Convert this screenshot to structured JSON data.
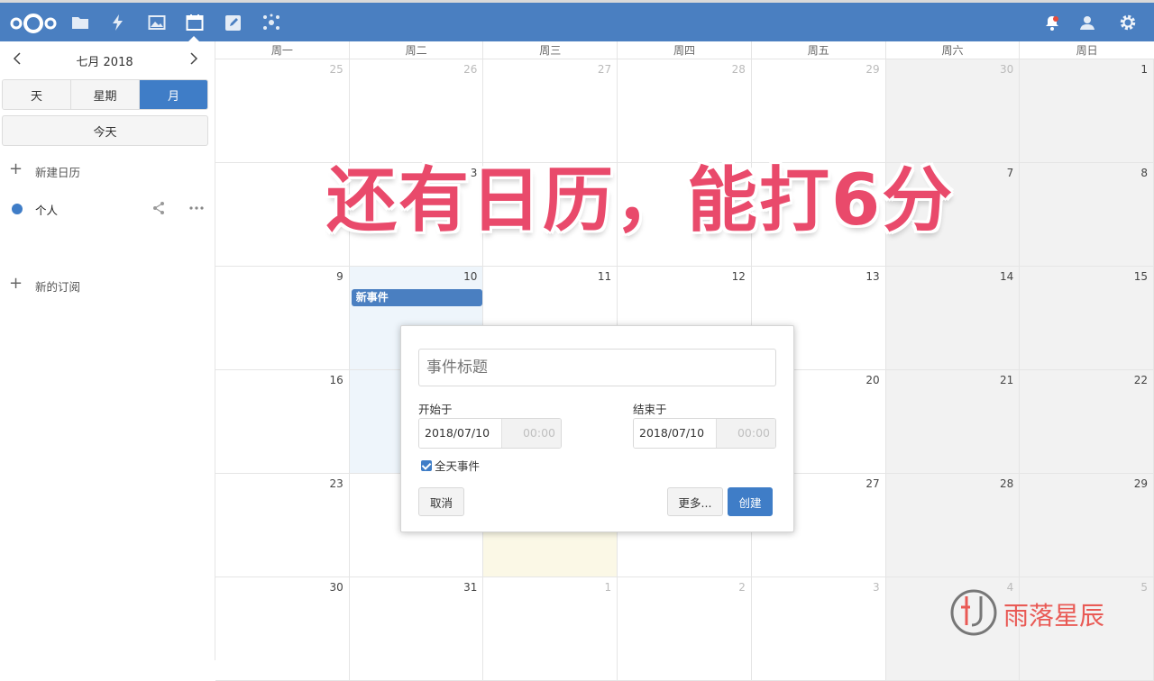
{
  "topbar": {
    "icons": [
      "nextcloud-logo",
      "files-icon",
      "activity-icon",
      "gallery-icon",
      "calendar-icon",
      "notes-icon",
      "circles-icon",
      "notifications-icon",
      "contacts-icon",
      "settings-icon"
    ],
    "accent": "#4a7fc1"
  },
  "sidebar": {
    "month_label": "七月 2018",
    "views": [
      "天",
      "星期",
      "月"
    ],
    "active_view": "月",
    "today_label": "今天",
    "new_calendar_label": "新建日历",
    "calendars": [
      {
        "name": "个人",
        "color": "#3f7dc7"
      }
    ],
    "new_subscription_label": "新的订阅"
  },
  "calendar": {
    "weekdays": [
      "周一",
      "周二",
      "周三",
      "周四",
      "周五",
      "周六",
      "周日"
    ],
    "weeks": [
      [
        "25",
        "26",
        "27",
        "28",
        "29",
        "30",
        "1"
      ],
      [
        "",
        "3",
        "",
        "",
        "",
        "7",
        "8"
      ],
      [
        "9",
        "10",
        "11",
        "12",
        "13",
        "14",
        "15"
      ],
      [
        "16",
        "",
        "",
        "",
        "20",
        "21",
        "22"
      ],
      [
        "23",
        "",
        "",
        "",
        "27",
        "28",
        "29"
      ],
      [
        "30",
        "31",
        "1",
        "2",
        "3",
        "4",
        "5"
      ]
    ],
    "event_label": "新事件"
  },
  "popup": {
    "title_placeholder": "事件标题",
    "start_label": "开始于",
    "start_date": "2018/07/10",
    "start_time": "00:00",
    "end_label": "结束于",
    "end_date": "2018/07/10",
    "end_time": "00:00",
    "allday_label": "全天事件",
    "allday_checked": true,
    "cancel_label": "取消",
    "more_label": "更多...",
    "create_label": "创建"
  },
  "overlay": {
    "caption": "还有日历，能打6分",
    "color": "#e94a6b"
  },
  "watermark": {
    "text": "雨落星辰"
  }
}
